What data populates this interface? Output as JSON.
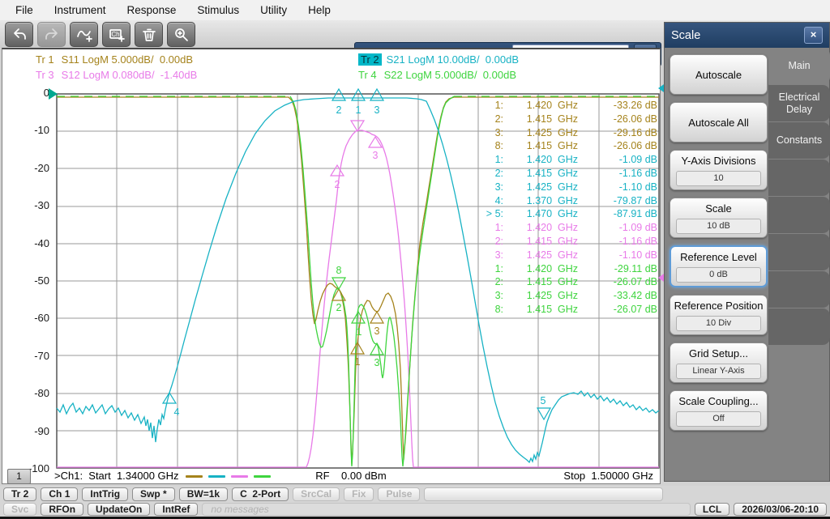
{
  "menu": {
    "items": [
      {
        "label": "File"
      },
      {
        "label": "Instrument"
      },
      {
        "label": "Response"
      },
      {
        "label": "Stimulus"
      },
      {
        "label": "Utility"
      },
      {
        "label": "Help"
      }
    ]
  },
  "toolbar": {
    "reference_level_label": "Reference Level",
    "reference_level_value": "0 dB"
  },
  "trace_labels_left": [
    {
      "id": "Tr 1",
      "text": "S11 LogM 5.000dB/  0.00dB",
      "cls": "c-olive"
    },
    {
      "id": "Tr 3",
      "text": "S12 LogM 0.080dB/  -1.40dB",
      "cls": "c-mag"
    }
  ],
  "trace_labels_right": [
    {
      "id": "Tr 2",
      "text": "S21 LogM 10.00dB/  0.00dB",
      "cls": "c-cyan active"
    },
    {
      "id": "Tr 4",
      "text": "S22 LogM 5.000dB/  0.00dB",
      "cls": "c-grn"
    }
  ],
  "y_ticks": [
    {
      "label": "0"
    },
    {
      "label": "-10"
    },
    {
      "label": "-20"
    },
    {
      "label": "-30"
    },
    {
      "label": "-40"
    },
    {
      "label": "-50"
    },
    {
      "label": "-60"
    },
    {
      "label": "-70"
    },
    {
      "label": "-80"
    },
    {
      "label": "-90"
    },
    {
      "label": "-100"
    }
  ],
  "marker_table": [
    {
      "n": "1:",
      "f": "1.420  GHz",
      "v": "-33.26 dB",
      "cls": "c-olive"
    },
    {
      "n": "2:",
      "f": "1.415  GHz",
      "v": "-26.06 dB",
      "cls": "c-olive"
    },
    {
      "n": "3:",
      "f": "1.425  GHz",
      "v": "-29.16 dB",
      "cls": "c-olive"
    },
    {
      "n": "8:",
      "f": "1.415  GHz",
      "v": "-26.06 dB",
      "cls": "c-olive"
    },
    {
      "n": "1:",
      "f": "1.420  GHz",
      "v": "-1.09 dB",
      "cls": "c-cyan"
    },
    {
      "n": "2:",
      "f": "1.415  GHz",
      "v": "-1.16 dB",
      "cls": "c-cyan"
    },
    {
      "n": "3:",
      "f": "1.425  GHz",
      "v": "-1.10 dB",
      "cls": "c-cyan"
    },
    {
      "n": "4:",
      "f": "1.370  GHz",
      "v": "-79.87 dB",
      "cls": "c-cyan"
    },
    {
      "n": "> 5:",
      "f": "1.470  GHz",
      "v": "-87.91 dB",
      "cls": "c-cyan"
    },
    {
      "n": "1:",
      "f": "1.420  GHz",
      "v": "-1.09 dB",
      "cls": "c-mag"
    },
    {
      "n": "2:",
      "f": "1.415  GHz",
      "v": "-1.16 dB",
      "cls": "c-mag"
    },
    {
      "n": "3:",
      "f": "1.425  GHz",
      "v": "-1.10 dB",
      "cls": "c-mag"
    },
    {
      "n": "1:",
      "f": "1.420  GHz",
      "v": "-29.11 dB",
      "cls": "c-grn"
    },
    {
      "n": "2:",
      "f": "1.415  GHz",
      "v": "-26.07 dB",
      "cls": "c-grn"
    },
    {
      "n": "3:",
      "f": "1.425  GHz",
      "v": "-33.42 dB",
      "cls": "c-grn"
    },
    {
      "n": "8:",
      "f": "1.415  GHz",
      "v": "-26.07 dB",
      "cls": "c-grn"
    }
  ],
  "channel_bar": {
    "number": "1",
    "start": ">Ch1:  Start  1.34000 GHz",
    "rf": "RF    0.00 dBm",
    "stop": "Stop  1.50000 GHz"
  },
  "scale_panel": {
    "title": "Scale",
    "close_icon": "×",
    "buttons": [
      {
        "label": "Autoscale",
        "value": "",
        "cls": "noval"
      },
      {
        "label": "Autoscale All",
        "value": "",
        "cls": "noval"
      },
      {
        "label": "Y-Axis Divisions",
        "value": "10",
        "cls": ""
      },
      {
        "label": "Scale",
        "value": "10 dB",
        "cls": ""
      },
      {
        "label": "Reference Level",
        "value": "0 dB",
        "cls": "hl"
      },
      {
        "label": "Reference Position",
        "value": "10 Div",
        "cls": ""
      },
      {
        "label": "Grid Setup...",
        "value": "Linear Y-Axis",
        "cls": ""
      },
      {
        "label": "Scale Coupling...",
        "value": "Off",
        "cls": ""
      }
    ],
    "tabs": [
      {
        "label": "Main",
        "cls": "active"
      },
      {
        "label": "Electrical Delay",
        "cls": ""
      },
      {
        "label": "Constants",
        "cls": ""
      }
    ]
  },
  "status": {
    "row1": [
      {
        "label": "Tr 2"
      },
      {
        "label": "Ch 1"
      },
      {
        "label": "IntTrig"
      },
      {
        "label": "Swp *"
      },
      {
        "label": "BW=1k"
      },
      {
        "label": "C  2-Port"
      },
      {
        "label": "SrcCal",
        "cls": "dis"
      },
      {
        "label": "Fix",
        "cls": "dis"
      },
      {
        "label": "Pulse",
        "cls": "dis"
      },
      {
        "label": " ",
        "cls": "dis grow"
      }
    ],
    "row2": [
      {
        "label": "Svc",
        "cls": "dis"
      },
      {
        "label": "RFOn"
      },
      {
        "label": "UpdateOn"
      },
      {
        "label": "IntRef"
      }
    ],
    "message": "no messages",
    "lcl": "LCL",
    "datetime": "2026/03/06-20:10"
  },
  "colors": {
    "olive": "#a5831c",
    "cyan": "#17b2c4",
    "magenta": "#e87ae8",
    "green": "#3ed43e",
    "accent_navy": "#2c4a70",
    "active_trace_chip": "#00b7c8"
  },
  "chart_data": {
    "type": "line",
    "title": "Bandpass filter S-parameter measurement centered near 1.42 GHz",
    "x_axis": {
      "start": "1.34000 GHz",
      "stop": "1.50000 GHz",
      "rf_power": "0.00 dBm",
      "divisions": 10
    },
    "y_axis": {
      "ref_db": 0,
      "scale_db_per_div": 10,
      "divisions": 10,
      "ticks": [
        0,
        -10,
        -20,
        -30,
        -40,
        -50,
        -60,
        -70,
        -80,
        -90,
        -100
      ]
    },
    "series": [
      {
        "name": "Tr 1 S11",
        "format": "LogM",
        "scale": "5.000dB/",
        "ref": "0.00dB",
        "color": "#a5831c",
        "markers": [
          {
            "n": 1,
            "freq_ghz": 1.42,
            "value_db": -33.26
          },
          {
            "n": 2,
            "freq_ghz": 1.415,
            "value_db": -26.06
          },
          {
            "n": 3,
            "freq_ghz": 1.425,
            "value_db": -29.16
          },
          {
            "n": 8,
            "freq_ghz": 1.415,
            "value_db": -26.06
          }
        ]
      },
      {
        "name": "Tr 2 S21",
        "format": "LogM",
        "scale": "10.00dB/",
        "ref": "0.00dB",
        "color": "#17b2c4",
        "markers": [
          {
            "n": 1,
            "freq_ghz": 1.42,
            "value_db": -1.09
          },
          {
            "n": 2,
            "freq_ghz": 1.415,
            "value_db": -1.16
          },
          {
            "n": 3,
            "freq_ghz": 1.425,
            "value_db": -1.1
          },
          {
            "n": 4,
            "freq_ghz": 1.37,
            "value_db": -79.87
          },
          {
            "n": 5,
            "freq_ghz": 1.47,
            "value_db": -87.91,
            "active": true
          }
        ]
      },
      {
        "name": "Tr 3 S12",
        "format": "LogM",
        "scale": "0.080dB/",
        "ref": "-1.40dB",
        "color": "#e87ae8",
        "markers": [
          {
            "n": 1,
            "freq_ghz": 1.42,
            "value_db": -1.09
          },
          {
            "n": 2,
            "freq_ghz": 1.415,
            "value_db": -1.16
          },
          {
            "n": 3,
            "freq_ghz": 1.425,
            "value_db": -1.1
          }
        ]
      },
      {
        "name": "Tr 4 S22",
        "format": "LogM",
        "scale": "5.000dB/",
        "ref": "0.00dB",
        "color": "#3ed43e",
        "markers": [
          {
            "n": 1,
            "freq_ghz": 1.42,
            "value_db": -29.11
          },
          {
            "n": 2,
            "freq_ghz": 1.415,
            "value_db": -26.07
          },
          {
            "n": 3,
            "freq_ghz": 1.425,
            "value_db": -33.42
          },
          {
            "n": 8,
            "freq_ghz": 1.415,
            "value_db": -26.07
          }
        ]
      }
    ]
  }
}
